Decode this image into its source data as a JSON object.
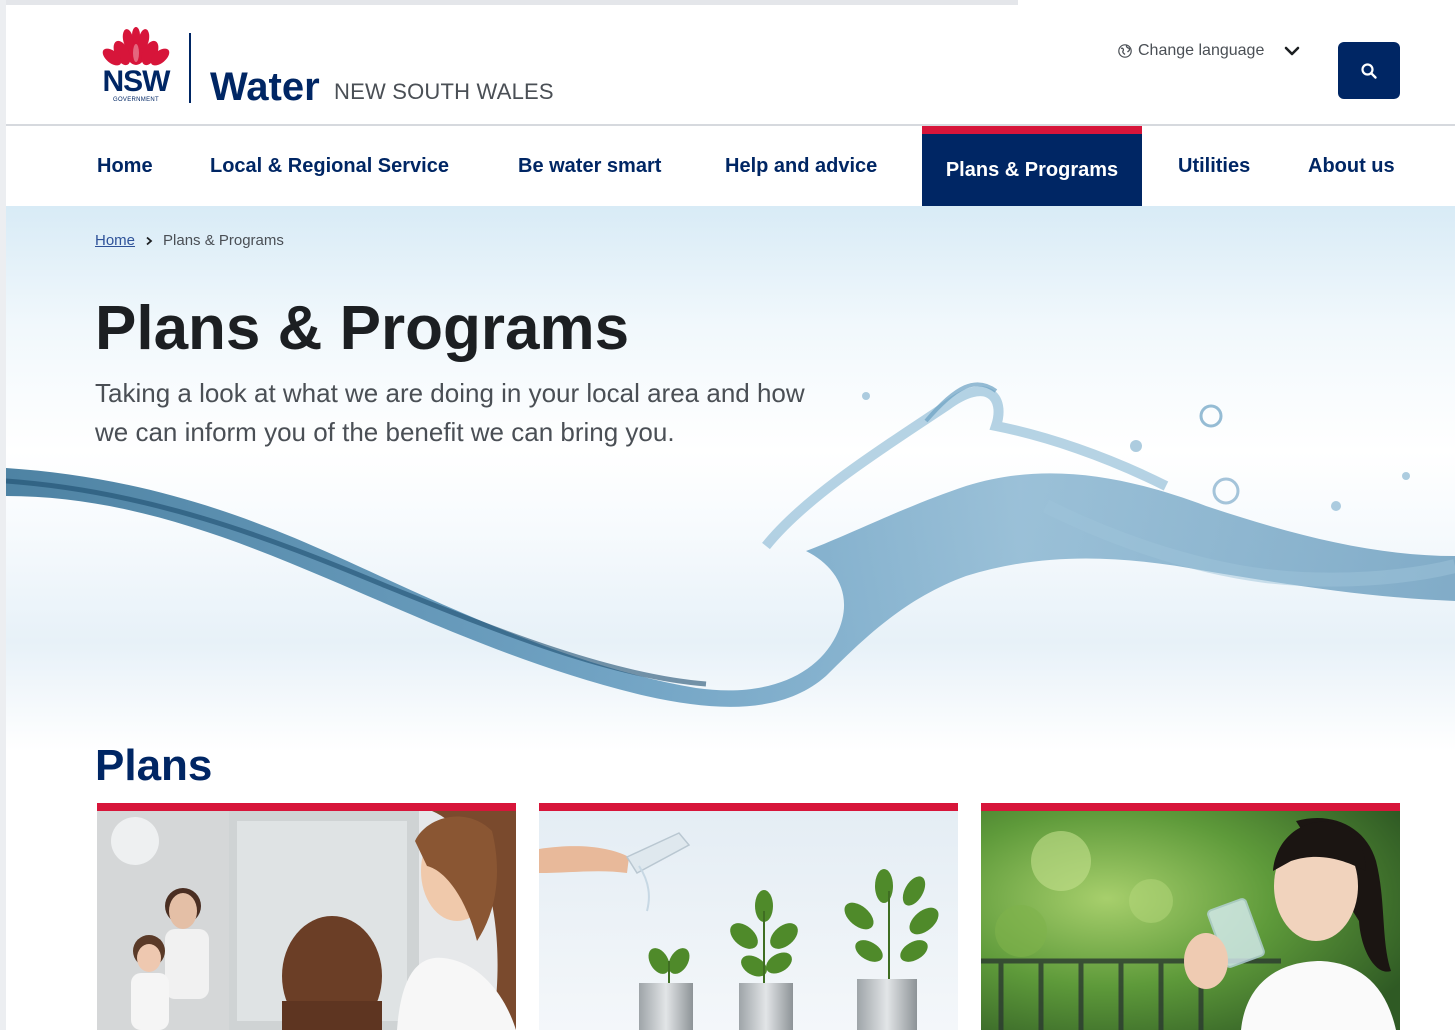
{
  "site": {
    "logo_text": "NSW",
    "logo_subtext": "GOVERNMENT",
    "brand_name": "Water",
    "brand_region": "NEW SOUTH WALES"
  },
  "header": {
    "language_label": "Change language",
    "search_icon": "search-icon",
    "globe_icon": "globe-icon",
    "chevron_icon": "chevron-down-icon"
  },
  "nav": {
    "items": [
      {
        "label": "Home"
      },
      {
        "label": "Local & Regional Service"
      },
      {
        "label": "Be water smart"
      },
      {
        "label": "Help and advice"
      },
      {
        "label": "Plans & Programs",
        "active": true
      },
      {
        "label": "Utilities"
      },
      {
        "label": "About us"
      }
    ]
  },
  "breadcrumb": {
    "home": "Home",
    "current": "Plans & Programs"
  },
  "page": {
    "title": "Plans & Programs",
    "intro": "Taking a look at what we are doing in your local area and how we can inform you of the benefit we can bring you."
  },
  "plans": {
    "heading": "Plans",
    "cards": [
      {
        "image": "family-bathroom-mirror-photo"
      },
      {
        "image": "plants-in-pots-watering-photo"
      },
      {
        "image": "woman-drinking-water-photo"
      }
    ]
  },
  "colors": {
    "navy": "#002664",
    "red": "#d7153a",
    "text": "#1c1f22",
    "muted": "#4a4f55"
  }
}
